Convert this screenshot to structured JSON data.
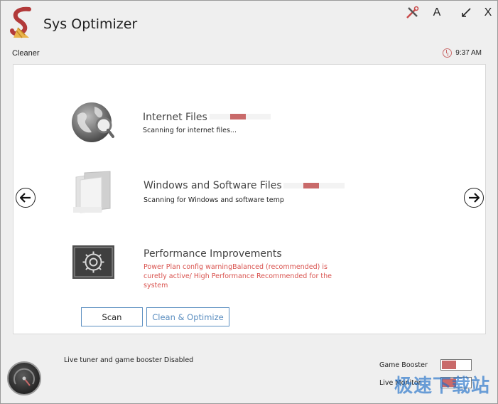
{
  "app": {
    "title": "Sys Optimizer",
    "section": "Cleaner",
    "clock_time": "9:37 AM"
  },
  "toolbar": {
    "tools_icon": "tools-icon",
    "font_label": "A",
    "minimize_icon": "minimize-arrow-icon",
    "close_label": "X"
  },
  "items": [
    {
      "title": "Internet Files",
      "status": "Scanning for internet files...",
      "icon": "globe-search-icon",
      "progress": 0.35
    },
    {
      "title": "Windows and Software Files",
      "status": "Scanning for Windows and software temp",
      "icon": "folder-icon",
      "progress": 0.35
    },
    {
      "title": "Performance Improvements",
      "warning": "Power Plan config warningBalanced (recommended) is curetly active/ High Performance Recommended for the system",
      "icon": "gear-icon"
    }
  ],
  "nav": {
    "prev_icon": "arrow-left-icon",
    "next_icon": "arrow-right-icon"
  },
  "buttons": {
    "scan": "Scan",
    "clean": "Clean & Optimize"
  },
  "footer": {
    "status": "Live tuner and game booster Disabled",
    "game_booster_label": "Game Booster",
    "live_monitor_label": "Live Monitor"
  },
  "watermark": "极速下载站",
  "colors": {
    "accent": "#c96a6a",
    "button_border": "#5b8ec0",
    "warning": "#d9534f"
  }
}
